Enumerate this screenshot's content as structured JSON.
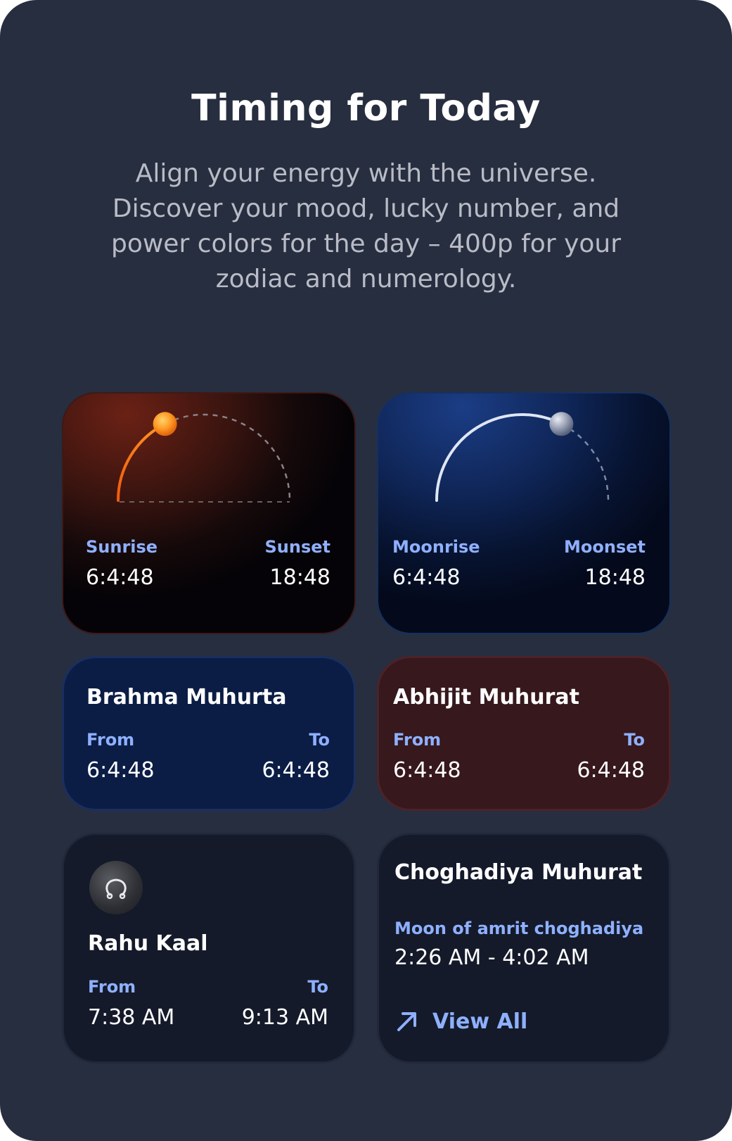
{
  "header": {
    "title": "Timing for Today",
    "subtitle": "Align your energy with the universe. Discover your mood, lucky number, and power colors for the day – 400p for your zodiac and numerology."
  },
  "sun": {
    "rise_label": "Sunrise",
    "rise_time": "6:4:48",
    "set_label": "Sunset",
    "set_time": "18:48",
    "progress": 0.35
  },
  "moon": {
    "rise_label": "Moonrise",
    "rise_time": "6:4:48",
    "set_label": "Moonset",
    "set_time": "18:48",
    "progress": 0.65
  },
  "brahma": {
    "title": "Brahma Muhurta",
    "from_label": "From",
    "from_time": "6:4:48",
    "to_label": "To",
    "to_time": "6:4:48"
  },
  "abhijit": {
    "title": "Abhijit Muhurat",
    "from_label": "From",
    "from_time": "6:4:48",
    "to_label": "To",
    "to_time": "6:4:48"
  },
  "rahu": {
    "icon": "rahu-symbol-icon",
    "title": "Rahu Kaal",
    "from_label": "From",
    "from_time": "7:38 AM",
    "to_label": "To",
    "to_time": "9:13 AM"
  },
  "choghadiya": {
    "title": "Choghadiya Muhurat",
    "subtitle": "Moon of amrit choghadiya",
    "time_range": "2:26 AM - 4:02 AM",
    "view_all_label": "View All",
    "view_all_icon": "arrow-up-right-icon"
  },
  "colors": {
    "background": "#272e3f",
    "accent_label": "#8fb0ff",
    "sun_orange": "#ff8a1f",
    "moon_silver": "#dfe6f5"
  }
}
